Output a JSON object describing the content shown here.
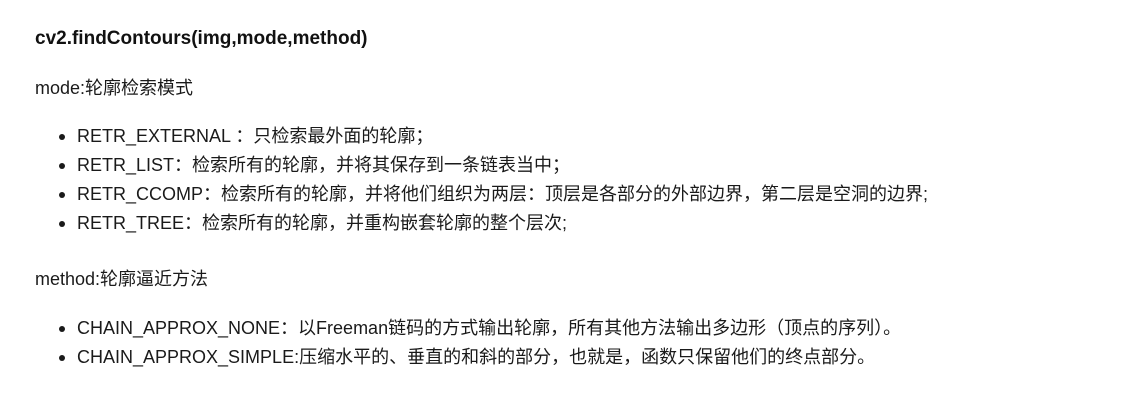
{
  "signature": "cv2.findContours(img,mode,method)",
  "mode": {
    "title": "mode:轮廓检索模式",
    "items": [
      "RETR_EXTERNAL ：只检索最外面的轮廓；",
      "RETR_LIST：检索所有的轮廓，并将其保存到一条链表当中；",
      "RETR_CCOMP：检索所有的轮廓，并将他们组织为两层：顶层是各部分的外部边界，第二层是空洞的边界;",
      "RETR_TREE：检索所有的轮廓，并重构嵌套轮廓的整个层次;"
    ]
  },
  "method": {
    "title": "method:轮廓逼近方法",
    "items": [
      "CHAIN_APPROX_NONE：以Freeman链码的方式输出轮廓，所有其他方法输出多边形（顶点的序列）。",
      "CHAIN_APPROX_SIMPLE:压缩水平的、垂直的和斜的部分，也就是，函数只保留他们的终点部分。"
    ]
  }
}
